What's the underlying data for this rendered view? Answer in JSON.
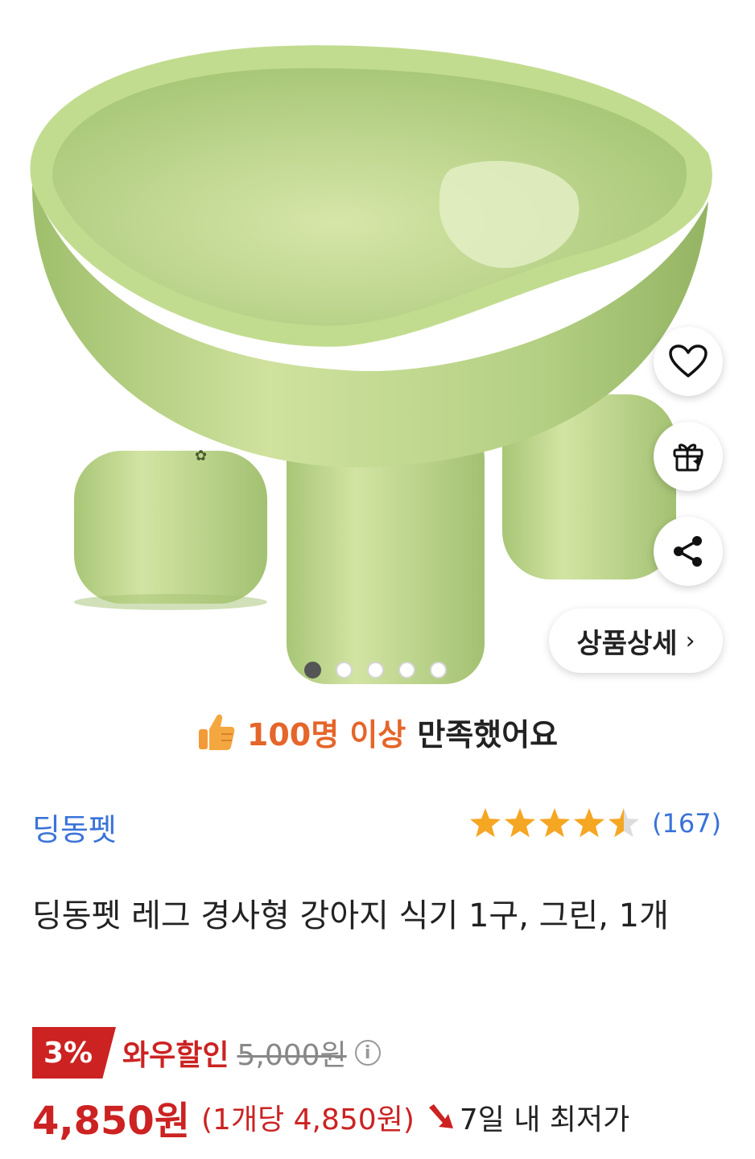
{
  "product_image": {
    "dots_total": 5,
    "dot_active_index": 0
  },
  "actions": {
    "wishlist_icon": "heart-icon",
    "gift_icon": "gift-icon",
    "share_icon": "share-icon",
    "detail_label": "상품상세",
    "detail_chevron": "›"
  },
  "satisfaction": {
    "icon": "thumbs-up-icon",
    "highlight": "100명 이상",
    "text": "만족했어요",
    "highlight_color": "#e5652a"
  },
  "brand": {
    "name": "딩동펫",
    "color": "#3a73d9"
  },
  "rating": {
    "stars": 4.5,
    "max": 5,
    "count": "(167)",
    "star_color": "#f5a623"
  },
  "product": {
    "title": "딩동펫 레그 경사형 강아지 식기 1구, 그린, 1개"
  },
  "pricing": {
    "discount_percent": "3%",
    "discount_label": "와우할인",
    "original_price": "5,000원",
    "info_icon": "i",
    "price": "4,850원",
    "unit_price": "(1개당 4,850원)",
    "lowest_label": "7일 내 최저가",
    "accent_color": "#cc2222"
  }
}
